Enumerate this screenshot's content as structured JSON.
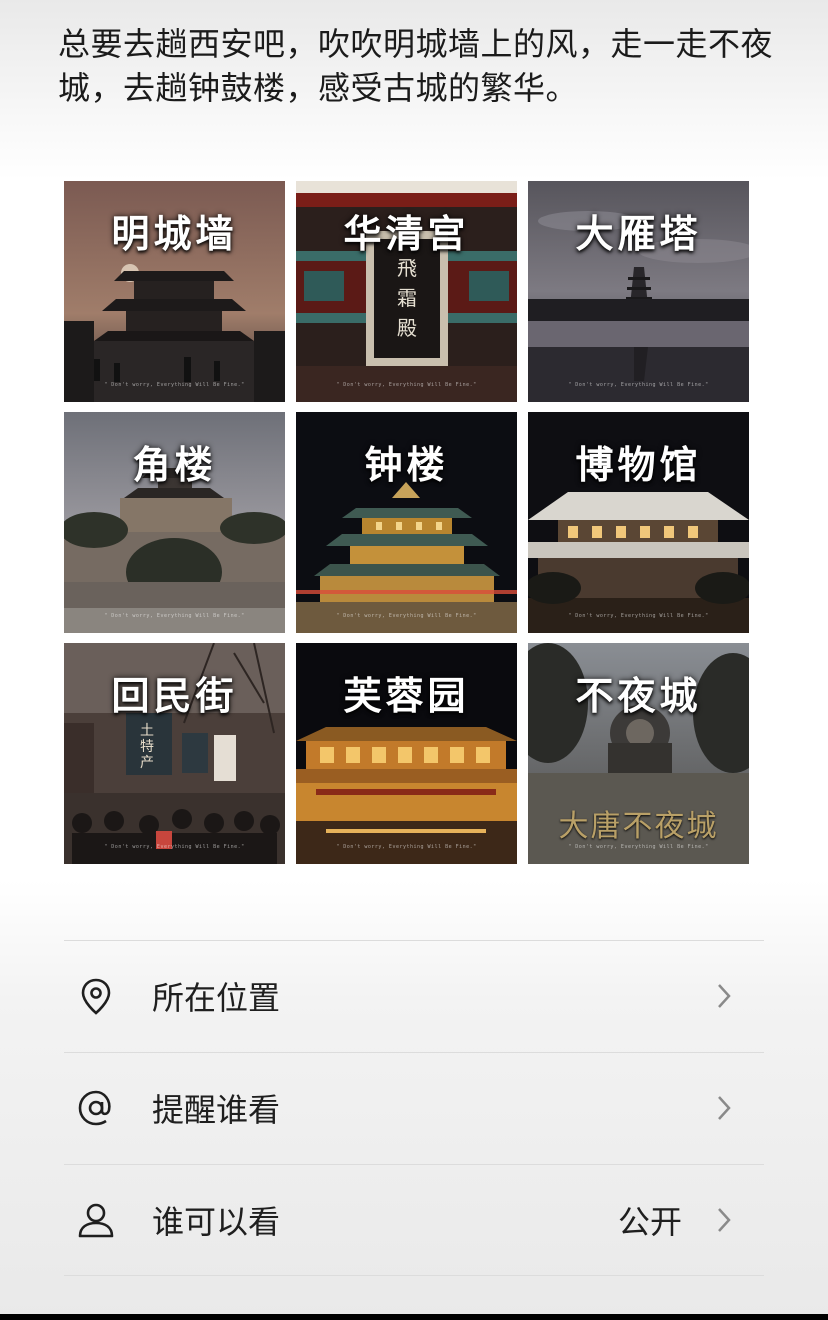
{
  "post": {
    "text": "总要去趟西安吧，吹吹明城墙上的风，走一走不夜城，去趟钟鼓楼，感受古城的繁华。"
  },
  "photos": [
    {
      "title": "明城墙",
      "watermark": "\" Don't worry, Everything Will Be Fine.\""
    },
    {
      "title": "华清宫",
      "plaque": "飛霜殿",
      "watermark": "\" Don't worry, Everything Will Be Fine.\""
    },
    {
      "title": "大雁塔",
      "watermark": "\" Don't worry, Everything Will Be Fine.\""
    },
    {
      "title": "角楼",
      "watermark": "\" Don't worry, Everything Will Be Fine.\""
    },
    {
      "title": "钟楼",
      "watermark": "\" Don't worry, Everything Will Be Fine.\""
    },
    {
      "title": "博物馆",
      "watermark": "\" Don't worry, Everything Will Be Fine.\""
    },
    {
      "title": "回民街",
      "sign": "土特产",
      "watermark": "\" Don't worry, Everything Will Be Fine.\""
    },
    {
      "title": "芙蓉园",
      "watermark": "\" Don't worry, Everything Will Be Fine.\""
    },
    {
      "title": "不夜城",
      "stone": "大唐不夜城",
      "watermark": "\" Don't worry, Everything Will Be Fine.\""
    }
  ],
  "options": {
    "location": {
      "label": "所在位置",
      "icon": "location-pin-icon"
    },
    "mention": {
      "label": "提醒谁看",
      "icon": "at-icon"
    },
    "visibility": {
      "label": "谁可以看",
      "value": "公开",
      "icon": "person-icon"
    }
  }
}
